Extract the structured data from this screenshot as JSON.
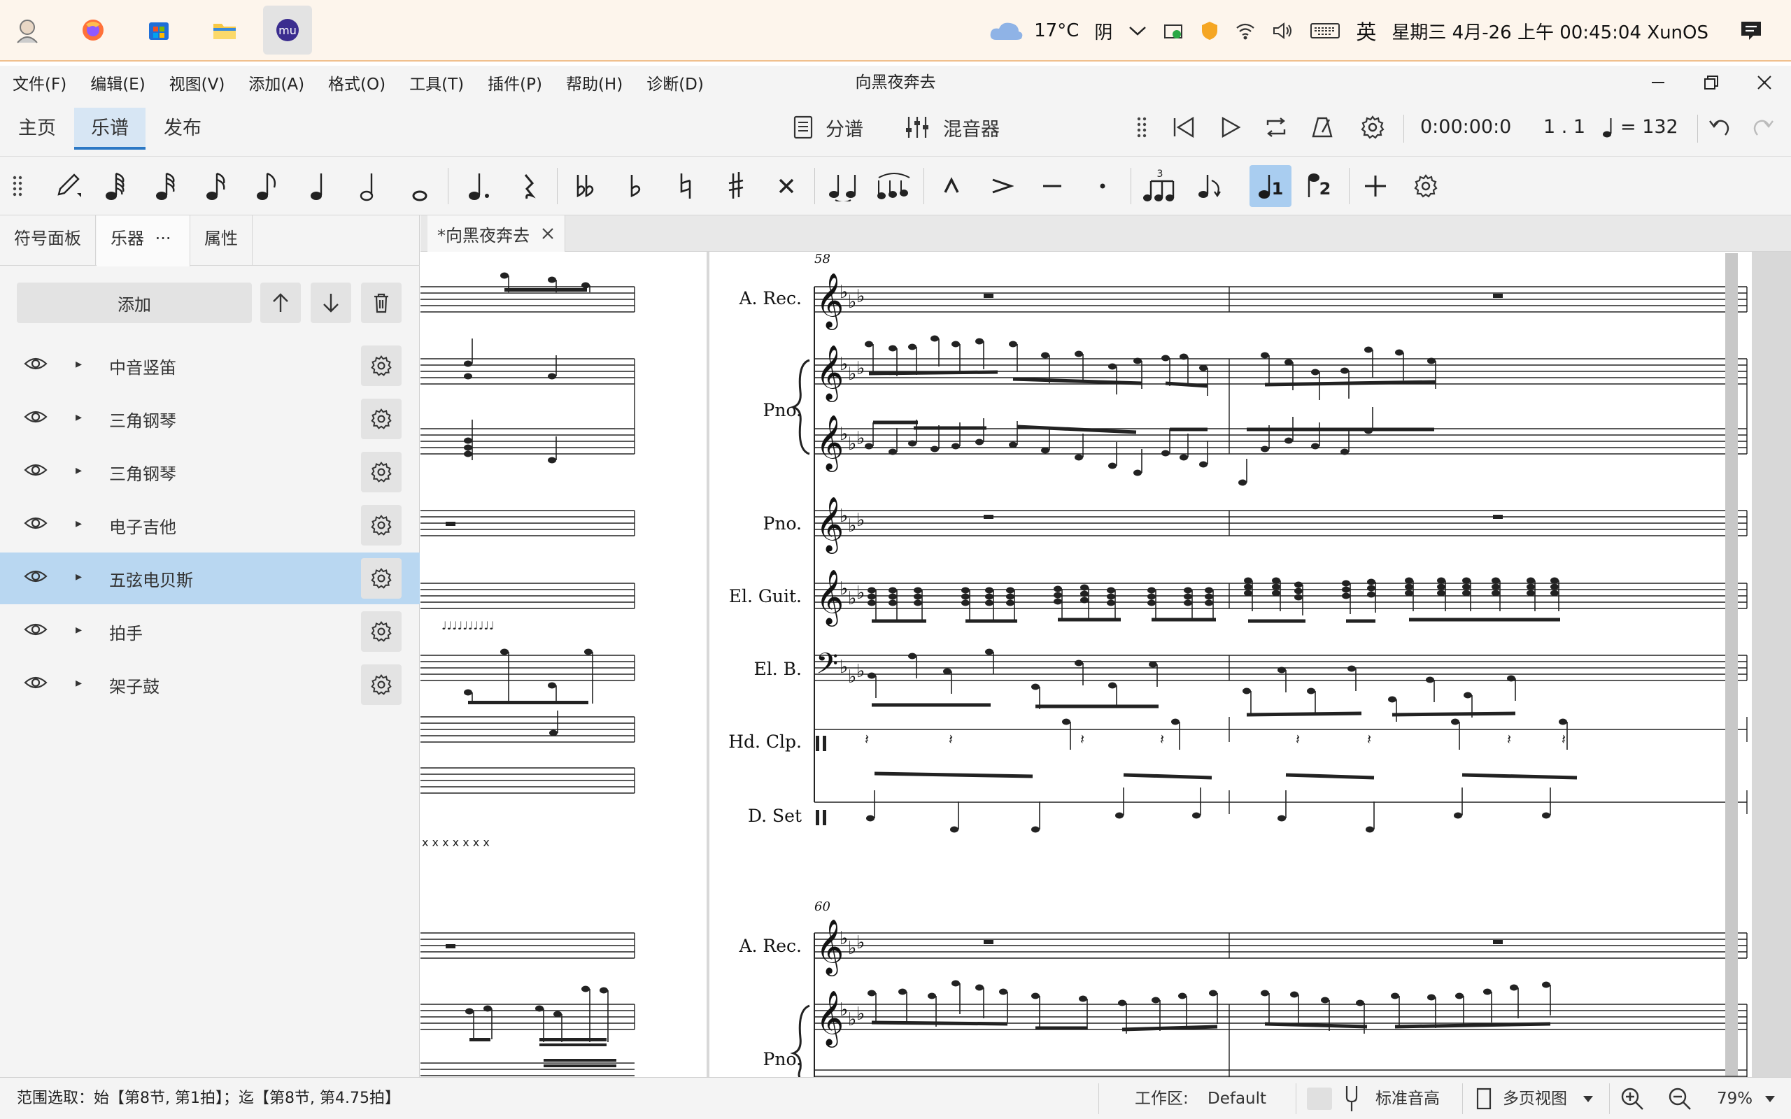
{
  "taskbar": {
    "weather_temp": "17°C",
    "weather_desc": "阴",
    "ime": "英",
    "datetime": "星期三 4月-26 上午 00:45:04 XunOS",
    "apps": [
      "app-avatar-icon",
      "firefox-icon",
      "store-icon",
      "file-manager-icon",
      "musescore-icon"
    ]
  },
  "menubar": {
    "items": [
      "文件(F)",
      "编辑(E)",
      "视图(V)",
      "添加(A)",
      "格式(O)",
      "工具(T)",
      "插件(P)",
      "帮助(H)",
      "诊断(D)"
    ],
    "window_title": "向黑夜奔去"
  },
  "tabs": {
    "home": "主页",
    "score": "乐谱",
    "publish": "发布",
    "parts": "分谱",
    "mixer": "混音器",
    "time": "0:00:00:0",
    "position": "1 . 1",
    "tempo": "= 132"
  },
  "panel": {
    "tabs": [
      "符号面板",
      "乐器",
      "属性"
    ],
    "more": "···",
    "add_button": "添加",
    "instruments": [
      {
        "name": "中音竖笛",
        "selected": false
      },
      {
        "name": "三角钢琴",
        "selected": false
      },
      {
        "name": "三角钢琴",
        "selected": false
      },
      {
        "name": "电子吉他",
        "selected": false
      },
      {
        "name": "五弦电贝斯",
        "selected": true
      },
      {
        "name": "拍手",
        "selected": false
      },
      {
        "name": "架子鼓",
        "selected": false
      }
    ]
  },
  "score": {
    "tab_label": "*向黑夜奔去",
    "system1_measure": "58",
    "system2_measure": "60",
    "staff_labels": [
      "A. Rec.",
      "Pno.",
      "Pno.",
      "El. Guit.",
      "El. B.",
      "Hd. Clp.",
      "D. Set"
    ],
    "system2_labels": [
      "A. Rec.",
      "Pno."
    ]
  },
  "status": {
    "selection": "范围选取：始【第8节, 第1拍】；迄【第8节, 第4.75拍】",
    "workspace_label": "工作区:",
    "workspace_value": "Default",
    "concert_pitch": "标准音高",
    "view_mode": "多页视图",
    "zoom": "79%"
  },
  "colors": {
    "accent": "#2b78c5",
    "selected_row": "#b9d7f1",
    "toggle_on": "#a9cdf0"
  }
}
